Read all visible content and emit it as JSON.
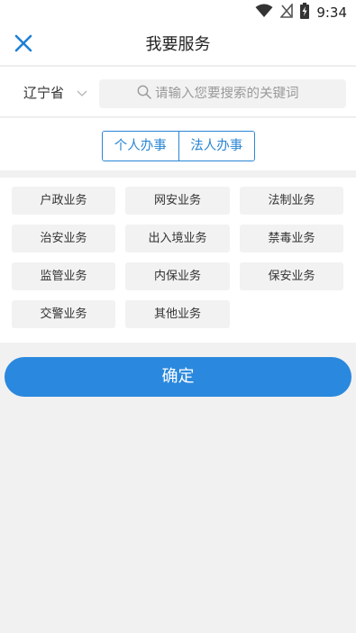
{
  "status_bar": {
    "time": "9:34",
    "icons": [
      "wifi-icon",
      "no-signal-icon",
      "battery-charging-icon"
    ]
  },
  "header": {
    "title": "我要服务",
    "close_icon": "close-icon"
  },
  "search": {
    "province": "辽宁省",
    "placeholder": "请输入您要搜索的关键词",
    "value": ""
  },
  "tabs": [
    {
      "label": "个人办事"
    },
    {
      "label": "法人办事"
    }
  ],
  "categories": [
    {
      "label": "户政业务"
    },
    {
      "label": "网安业务"
    },
    {
      "label": "法制业务"
    },
    {
      "label": "治安业务"
    },
    {
      "label": "出入境业务"
    },
    {
      "label": "禁毒业务"
    },
    {
      "label": "监管业务"
    },
    {
      "label": "内保业务"
    },
    {
      "label": "保安业务"
    },
    {
      "label": "交警业务"
    },
    {
      "label": "其他业务"
    }
  ],
  "confirm_label": "确定",
  "colors": {
    "accent": "#2a86d4",
    "confirm": "#2a88de",
    "background": "#f1f1f1",
    "chip": "#f2f2f2"
  }
}
